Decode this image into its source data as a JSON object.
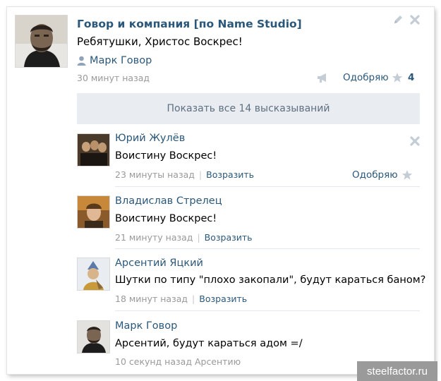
{
  "post": {
    "title": "Говор и компания [по Name Studio]",
    "text": "Ребятушки, Христос Воскрес!",
    "author": "Марк Говор",
    "time": "30 минут назад",
    "like_label": "Одобряю",
    "like_count": "4"
  },
  "show_all": "Показать все 14 высказываний",
  "comments": [
    {
      "name": "Юрий Жулёв",
      "text": "Воистину Воскрес!",
      "time": "23 минуты назад",
      "reply": "Возразить",
      "like_label": "Одобряю"
    },
    {
      "name": "Владислав Стрелец",
      "text": "Воистину Воскрес!",
      "time": "21 минуту назад",
      "reply": "Возразить"
    },
    {
      "name": "Арсентий Яцкий",
      "text": "Шутки по типу \"плохо закопали\", будут караться баном?",
      "time": "18 минут назад",
      "reply": "Возразить"
    },
    {
      "name": "Марк Говор",
      "text": "Арсентий, будут караться адом =/",
      "time": "10 секунд назад",
      "reply_to": "Арсентию"
    }
  ],
  "watermark": "steelfactor.ru",
  "icons": {
    "edit": "pencil-icon",
    "close": "close-icon",
    "author": "user-icon",
    "share": "megaphone-icon",
    "like": "star-icon"
  },
  "colors": {
    "link": "#2b587a",
    "meta": "#999999",
    "show_all_bg": "#e9edf1",
    "icon_gray": "#c4ccd6"
  }
}
